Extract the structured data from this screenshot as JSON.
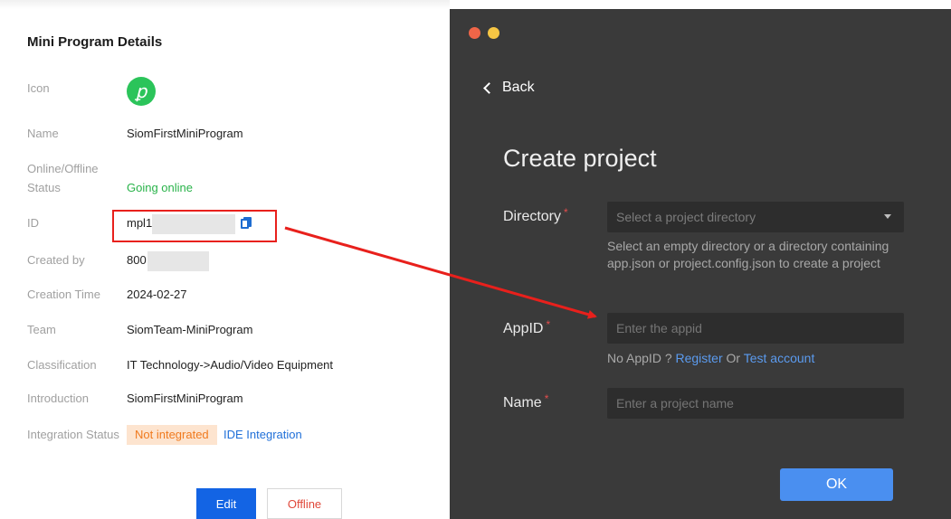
{
  "details": {
    "title": "Mini Program Details",
    "rows": {
      "icon": {
        "label": "Icon",
        "glyph": "ꝑ"
      },
      "name": {
        "label": "Name",
        "value": "SiomFirstMiniProgram"
      },
      "status": {
        "label_line1": "Online/Offline",
        "label_line2": "Status",
        "value": "Going online"
      },
      "id": {
        "label": "ID",
        "value": "mpl1"
      },
      "created_by": {
        "label": "Created by",
        "value": "800"
      },
      "creation_time": {
        "label": "Creation Time",
        "value": "2024-02-27"
      },
      "team": {
        "label": "Team",
        "value": "SiomTeam-MiniProgram"
      },
      "classification": {
        "label": "Classification",
        "value": "IT Technology->Audio/Video Equipment"
      },
      "introduction": {
        "label": "Introduction",
        "value": "SiomFirstMiniProgram"
      },
      "integration": {
        "label": "Integration Status",
        "badge": "Not integrated",
        "link": "IDE Integration"
      }
    },
    "buttons": {
      "edit": "Edit",
      "offline": "Offline"
    }
  },
  "create_window": {
    "back": "Back",
    "title": "Create project",
    "directory": {
      "label": "Directory",
      "placeholder": "Select a project directory",
      "hint": "Select an empty directory or a directory containing app.json or project.config.json to create a project"
    },
    "appid": {
      "label": "AppID",
      "placeholder": "Enter the appid",
      "hint_prefix": "No AppID ?",
      "register": "Register",
      "or": "Or",
      "test_account": "Test account"
    },
    "name": {
      "label": "Name",
      "placeholder": "Enter a project name"
    },
    "required_mark": "*",
    "ok": "OK"
  },
  "colors": {
    "accent": "#1364e4",
    "annotation": "#e8201c",
    "dark_bg": "#3a3a3a"
  }
}
